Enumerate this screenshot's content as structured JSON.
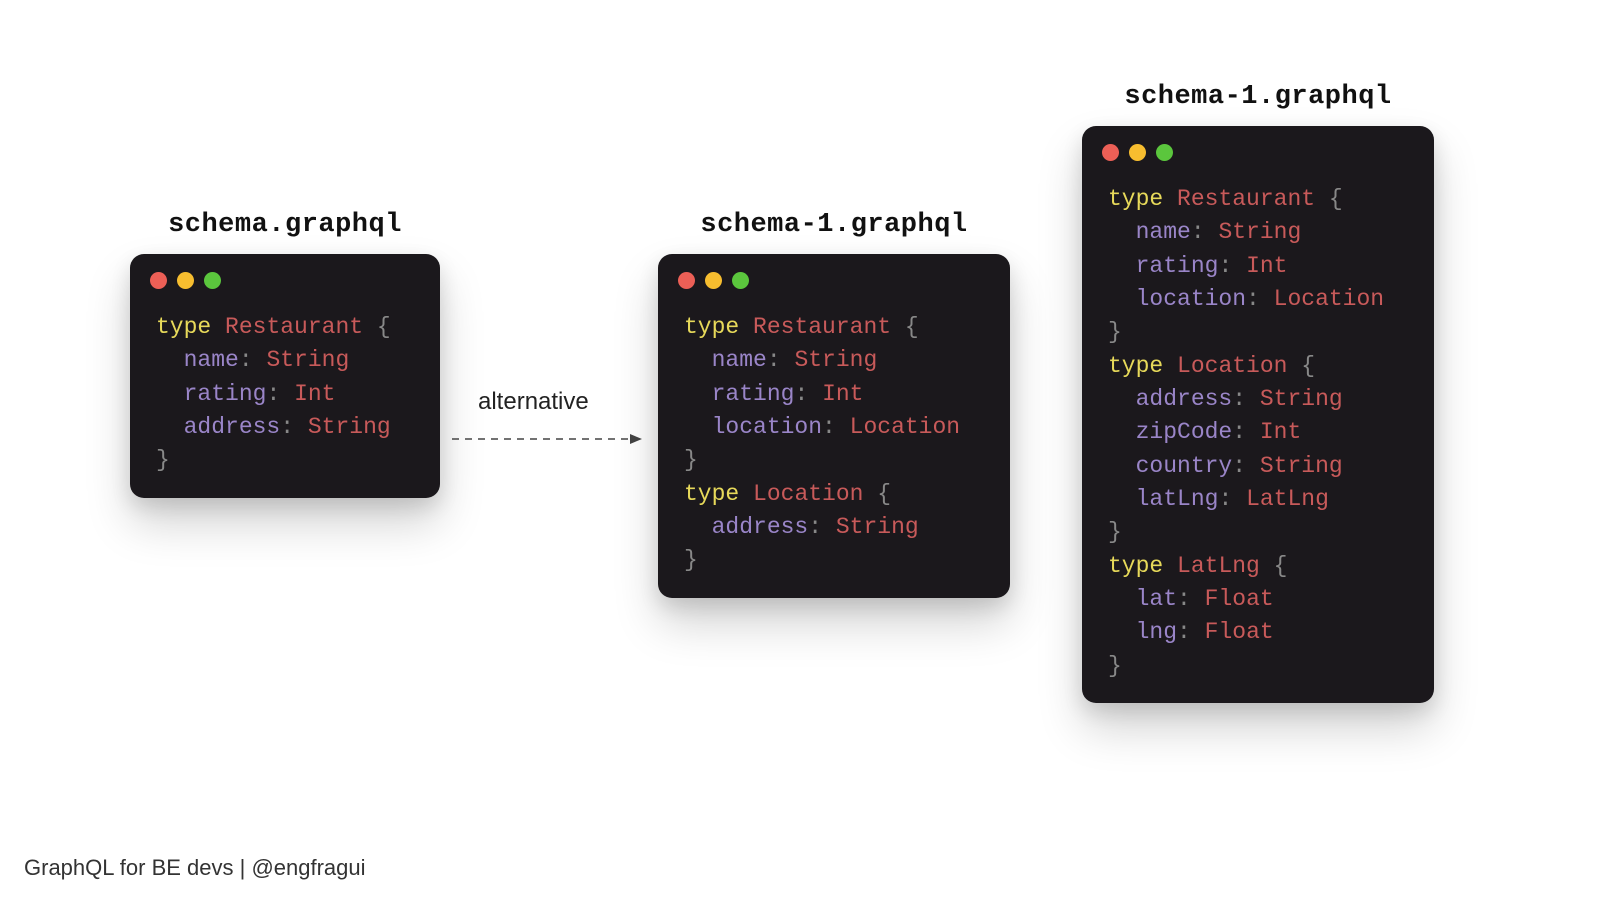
{
  "footer": "GraphQL for BE devs | @engfragui",
  "arrow_label": "alternative",
  "panels": [
    {
      "title": "schema.graphql",
      "types": [
        {
          "name": "Restaurant",
          "fields": [
            {
              "name": "name",
              "type": "String"
            },
            {
              "name": "rating",
              "type": "Int"
            },
            {
              "name": "address",
              "type": "String"
            }
          ]
        }
      ]
    },
    {
      "title": "schema-1.graphql",
      "types": [
        {
          "name": "Restaurant",
          "fields": [
            {
              "name": "name",
              "type": "String"
            },
            {
              "name": "rating",
              "type": "Int"
            },
            {
              "name": "location",
              "type": "Location"
            }
          ]
        },
        {
          "name": "Location",
          "fields": [
            {
              "name": "address",
              "type": "String"
            }
          ]
        }
      ]
    },
    {
      "title": "schema-1.graphql",
      "types": [
        {
          "name": "Restaurant",
          "fields": [
            {
              "name": "name",
              "type": "String"
            },
            {
              "name": "rating",
              "type": "Int"
            },
            {
              "name": "location",
              "type": "Location"
            }
          ]
        },
        {
          "name": "Location",
          "fields": [
            {
              "name": "address",
              "type": "String"
            },
            {
              "name": "zipCode",
              "type": "Int"
            },
            {
              "name": "country",
              "type": "String"
            },
            {
              "name": "latLng",
              "type": "LatLng"
            }
          ]
        },
        {
          "name": "LatLng",
          "fields": [
            {
              "name": "lat",
              "type": "Float"
            },
            {
              "name": "lng",
              "type": "Float"
            }
          ]
        }
      ]
    }
  ]
}
